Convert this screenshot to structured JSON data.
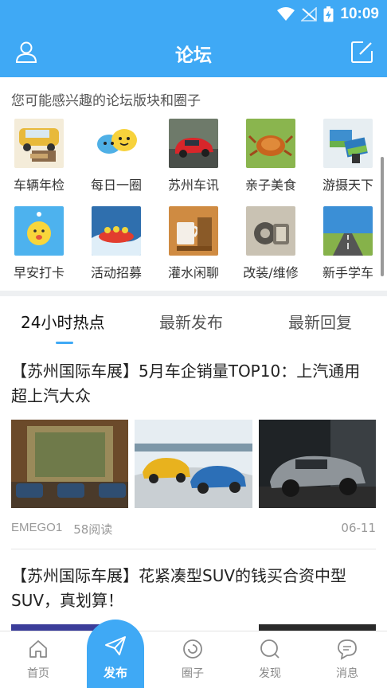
{
  "status_bar": {
    "time": "10:09"
  },
  "header": {
    "title": "论坛",
    "left_icon": "user-icon",
    "right_icon": "edit-icon"
  },
  "interest": {
    "title": "您可能感兴趣的论坛版块和圈子",
    "items": [
      {
        "label": "车辆年检",
        "icon": "car-inspection-thumb"
      },
      {
        "label": "每日一圈",
        "icon": "chat-bubbles-thumb"
      },
      {
        "label": "苏州车讯",
        "icon": "red-car-thumb"
      },
      {
        "label": "亲子美食",
        "icon": "crab-dish-thumb"
      },
      {
        "label": "游摄天下",
        "icon": "photo-travel-thumb"
      },
      {
        "label": "早安打卡",
        "icon": "good-morning-thumb"
      },
      {
        "label": "活动招募",
        "icon": "rafting-thumb"
      },
      {
        "label": "灌水闲聊",
        "icon": "coffee-thumb"
      },
      {
        "label": "改装/维修",
        "icon": "car-parts-thumb"
      },
      {
        "label": "新手学车",
        "icon": "road-thumb"
      }
    ]
  },
  "tabs": [
    {
      "label": "24小时热点",
      "active": true
    },
    {
      "label": "最新发布",
      "active": false
    },
    {
      "label": "最新回复",
      "active": false
    }
  ],
  "posts": [
    {
      "title": "【苏州国际车展】5月车企销量TOP10：上汽通用超上汽大众",
      "author": "EMEGO1",
      "views": "58阅读",
      "date": "06-11"
    },
    {
      "title": "【苏州国际车展】花紧凑型SUV的钱买合资中型SUV，真划算！"
    }
  ],
  "bottom_nav": {
    "home": "首页",
    "publish": "发布",
    "circle": "圈子",
    "discover": "发现",
    "messages": "消息"
  },
  "colors": {
    "accent": "#3fa9f5"
  }
}
